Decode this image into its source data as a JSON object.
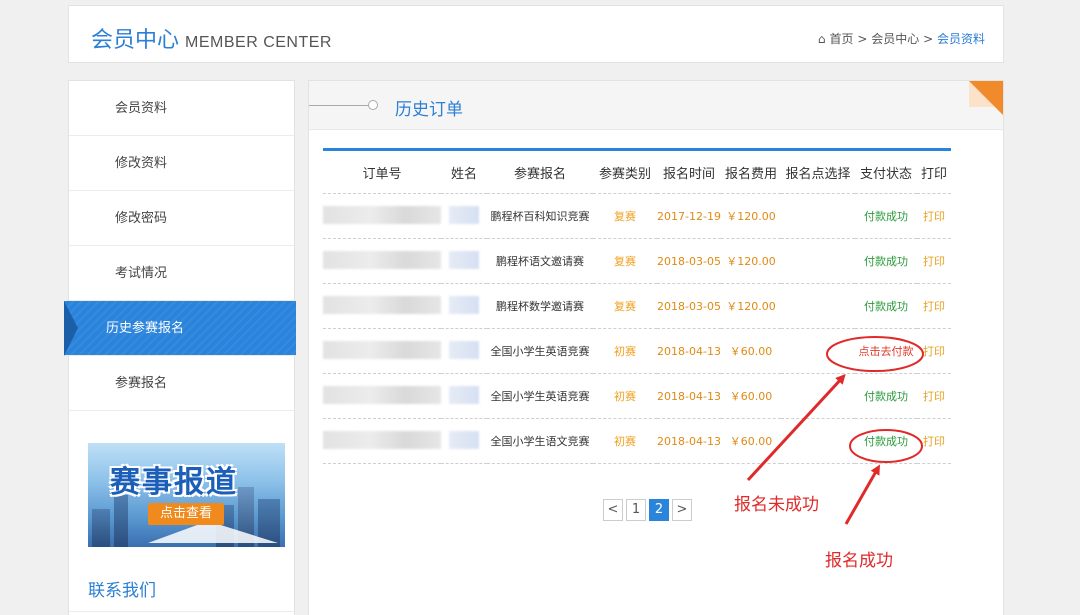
{
  "header": {
    "title_cn": "会员中心",
    "title_en": "MEMBER CENTER",
    "breadcrumb": {
      "home": "首页",
      "sep": ">",
      "level1": "会员中心",
      "current": "会员资料"
    }
  },
  "sidebar": {
    "items": [
      {
        "label": "会员资料"
      },
      {
        "label": "修改资料"
      },
      {
        "label": "修改密码"
      },
      {
        "label": "考试情况"
      },
      {
        "label": "历史参赛报名"
      },
      {
        "label": "参赛报名"
      }
    ],
    "banner": {
      "headline": "赛事报道",
      "cta": "点击查看"
    },
    "contact": "联系我们"
  },
  "main": {
    "heading": "历史订单",
    "columns": [
      "订单号",
      "姓名",
      "参赛报名",
      "参赛类别",
      "报名时间",
      "报名费用",
      "报名点选择",
      "支付状态",
      "打印"
    ],
    "rows": [
      {
        "contest": "鹏程杯百科知识竞赛",
        "category": "复赛",
        "date": "2017-12-19",
        "fee": "￥120.00",
        "site": "",
        "status": "付款成功",
        "print": "打印"
      },
      {
        "contest": "鹏程杯语文邀请赛",
        "category": "复赛",
        "date": "2018-03-05",
        "fee": "￥120.00",
        "site": "",
        "status": "付款成功",
        "print": "打印"
      },
      {
        "contest": "鹏程杯数学邀请赛",
        "category": "复赛",
        "date": "2018-03-05",
        "fee": "￥120.00",
        "site": "",
        "status": "付款成功",
        "print": "打印"
      },
      {
        "contest": "全国小学生英语竞赛",
        "category": "初赛",
        "date": "2018-04-13",
        "fee": "￥60.00",
        "site": "",
        "status": "点击去付款",
        "print": "打印"
      },
      {
        "contest": "全国小学生英语竞赛",
        "category": "初赛",
        "date": "2018-04-13",
        "fee": "￥60.00",
        "site": "",
        "status": "付款成功",
        "print": "打印"
      },
      {
        "contest": "全国小学生语文竞赛",
        "category": "初赛",
        "date": "2018-04-13",
        "fee": "￥60.00",
        "site": "",
        "status": "付款成功",
        "print": "打印"
      }
    ],
    "pagination": {
      "prev": "<",
      "pages": [
        "1",
        "2"
      ],
      "current": "2",
      "next": ">"
    }
  },
  "annotations": {
    "fail": "报名未成功",
    "success": "报名成功"
  },
  "colors": {
    "accent": "#2b84dc",
    "success": "#2a9a3a",
    "pay": "#e03a2a",
    "annotation": "#e02a2a"
  }
}
